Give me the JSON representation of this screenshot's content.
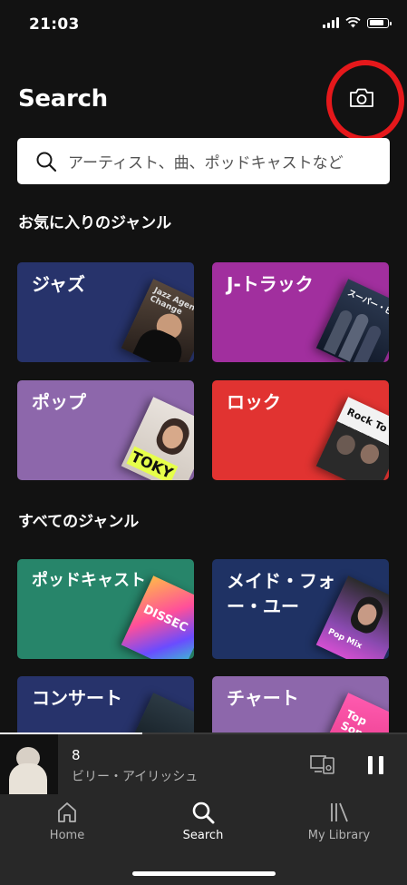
{
  "status_bar": {
    "time": "21:03"
  },
  "header": {
    "title": "Search"
  },
  "search": {
    "placeholder": "アーティスト、曲、ポッドキャストなど"
  },
  "sections": {
    "favorites": {
      "title": "お気に入りのジャンル",
      "tiles": [
        {
          "label": "ジャズ",
          "color": "#27336b",
          "art_text": "Jazz Agency Change"
        },
        {
          "label": "J-トラック",
          "color": "#a12f9e",
          "art_text": "スーパー・ビ"
        },
        {
          "label": "ポップ",
          "color": "#8d67ab",
          "art_text": "TOKY"
        },
        {
          "label": "ロック",
          "color": "#e13331",
          "art_text": "Rock To"
        }
      ]
    },
    "all": {
      "title": "すべてのジャンル",
      "tiles": [
        {
          "label": "ポッドキャスト",
          "color": "#27856a",
          "art_text": "DISSEC"
        },
        {
          "label": "メイド・フォー・ユー",
          "color": "#1f3264",
          "art_text": "Pop Mix"
        },
        {
          "label": "コンサート",
          "color": "#27336b",
          "art_text": ""
        },
        {
          "label": "チャート",
          "color": "#8d67ab",
          "art_text": "Top Songs"
        }
      ]
    }
  },
  "now_playing": {
    "title": "8",
    "artist": "ビリー・アイリッシュ",
    "progress": 0.35
  },
  "tabs": [
    {
      "label": "Home",
      "icon": "home-icon",
      "active": false
    },
    {
      "label": "Search",
      "icon": "search-icon",
      "active": true
    },
    {
      "label": "My Library",
      "icon": "library-icon",
      "active": false
    }
  ],
  "colors": {
    "background": "#121212",
    "player": "#282828",
    "highlight_ring": "#e5181b"
  }
}
